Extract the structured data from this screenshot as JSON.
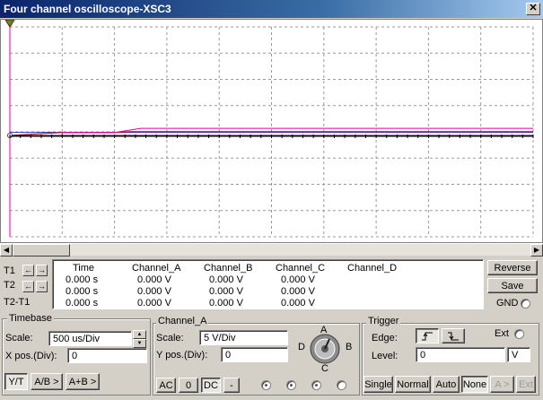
{
  "window": {
    "title": "Four channel oscilloscope-XSC3",
    "close_glyph": "✕"
  },
  "colors": {
    "channel_a": "#3030c0",
    "channel_b": "#c00000",
    "channel_c": "#e000a0",
    "channel_d": "#202020",
    "grid": "#9a9a9a"
  },
  "screen": {
    "traces": [
      {
        "name": "Channel_A",
        "points": [
          [
            0,
            0.86
          ],
          [
            0.1,
            0.86
          ],
          [
            1,
            0.86
          ]
        ]
      },
      {
        "name": "Channel_B",
        "points": [
          [
            0,
            0
          ],
          [
            0.1,
            0.12
          ],
          [
            0.2,
            0.12
          ],
          [
            0.23,
            0.16
          ],
          [
            1,
            0.16
          ]
        ]
      },
      {
        "name": "Channel_C",
        "points": [
          [
            0,
            0
          ],
          [
            0.1,
            0
          ],
          [
            0.1,
            0.12
          ],
          [
            0.2,
            0.12
          ],
          [
            0.25,
            0.3
          ],
          [
            1,
            0.3
          ]
        ]
      },
      {
        "name": "Channel_D",
        "points": [
          [
            0,
            0
          ],
          [
            1,
            0
          ]
        ]
      }
    ]
  },
  "scroll": {
    "left_glyph": "◀",
    "right_glyph": "▶"
  },
  "cursors": {
    "t1_label": "T1",
    "t2_label": "T2",
    "t2t1_label": "T2-T1",
    "left_glyph": "←",
    "right_glyph": "→"
  },
  "readout": {
    "headers": [
      "Time",
      "Channel_A",
      "Channel_B",
      "Channel_C",
      "Channel_D"
    ],
    "rows": [
      [
        "0.000 s",
        "0.000 V",
        "0.000 V",
        "0.000 V",
        ""
      ],
      [
        "0.000 s",
        "0.000 V",
        "0.000 V",
        "0.000 V",
        ""
      ],
      [
        "0.000 s",
        "0.000 V",
        "0.000 V",
        "0.000 V",
        ""
      ]
    ]
  },
  "side": {
    "reverse": "Reverse",
    "save": "Save",
    "gnd": "GND"
  },
  "timebase": {
    "title": "Timebase",
    "scale_label": "Scale:",
    "scale_value": "500 us/Div",
    "xpos_label": "X pos.(Div):",
    "xpos_value": "0",
    "yt": "Y/T",
    "ab": "A/B >",
    "apb": "A+B >",
    "up": "▲",
    "down": "▼"
  },
  "channel": {
    "title": "Channel_A",
    "scale_label": "Scale:",
    "scale_value": "5  V/Div",
    "ypos_label": "Y pos.(Div):",
    "ypos_value": "0",
    "ac": "AC",
    "zero": "0",
    "dc": "DC",
    "minus": "-",
    "knob_a": "A",
    "knob_b": "B",
    "knob_c": "C",
    "knob_d": "D"
  },
  "trigger": {
    "title": "Trigger",
    "edge_label": "Edge:",
    "ext_label": "Ext",
    "level_label": "Level:",
    "level_value": "0",
    "level_unit": "V",
    "rise_glyph": "⎍",
    "fall_glyph": "⎍",
    "single": "Single",
    "normal": "Normal",
    "auto": "Auto",
    "none": "None",
    "a_gt": "A >",
    "ext_btn": "Ext"
  }
}
